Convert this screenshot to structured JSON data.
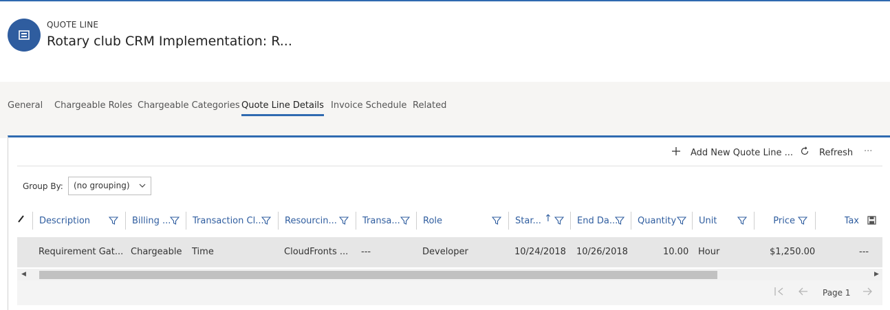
{
  "header": {
    "entity_type": "QUOTE LINE",
    "title": "Rotary club CRM Implementation: R...",
    "icon": "quote-line-icon"
  },
  "tabs": [
    {
      "label": "General"
    },
    {
      "label": "Chargeable Roles"
    },
    {
      "label": "Chargeable Categories"
    },
    {
      "label": "Quote Line Details",
      "active": true
    },
    {
      "label": "Invoice Schedule"
    },
    {
      "label": "Related"
    }
  ],
  "commands": {
    "add_label": "Add New Quote Line ...",
    "refresh_label": "Refresh",
    "more_label": "···"
  },
  "groupby": {
    "label": "Group By:",
    "value": "(no grouping)"
  },
  "grid": {
    "columns": [
      {
        "label": "Description"
      },
      {
        "label": "Billing ..."
      },
      {
        "label": "Transaction Cl..."
      },
      {
        "label": "Resourcin..."
      },
      {
        "label": "Transa..."
      },
      {
        "label": "Role"
      },
      {
        "label": "Star...",
        "sort": "ascending"
      },
      {
        "label": "End Da..."
      },
      {
        "label": "Quantity"
      },
      {
        "label": "Unit"
      },
      {
        "label": "Price"
      },
      {
        "label": "Tax"
      }
    ],
    "rows": [
      {
        "description": "Requirement Gat...",
        "billing": "Chargeable",
        "transaction_class": "Time",
        "resourcing": "CloudFronts ...",
        "transaction": "---",
        "role": "Developer",
        "start": "10/24/2018",
        "end": "10/26/2018",
        "quantity": "10.00",
        "unit": "Hour",
        "price": "$1,250.00",
        "tax": "---"
      }
    ]
  },
  "pager": {
    "page_label": "Page 1"
  },
  "colors": {
    "accent": "#2f6ab0",
    "entity_icon_bg": "#2f5d9f",
    "header_link": "#2f5d9f"
  }
}
